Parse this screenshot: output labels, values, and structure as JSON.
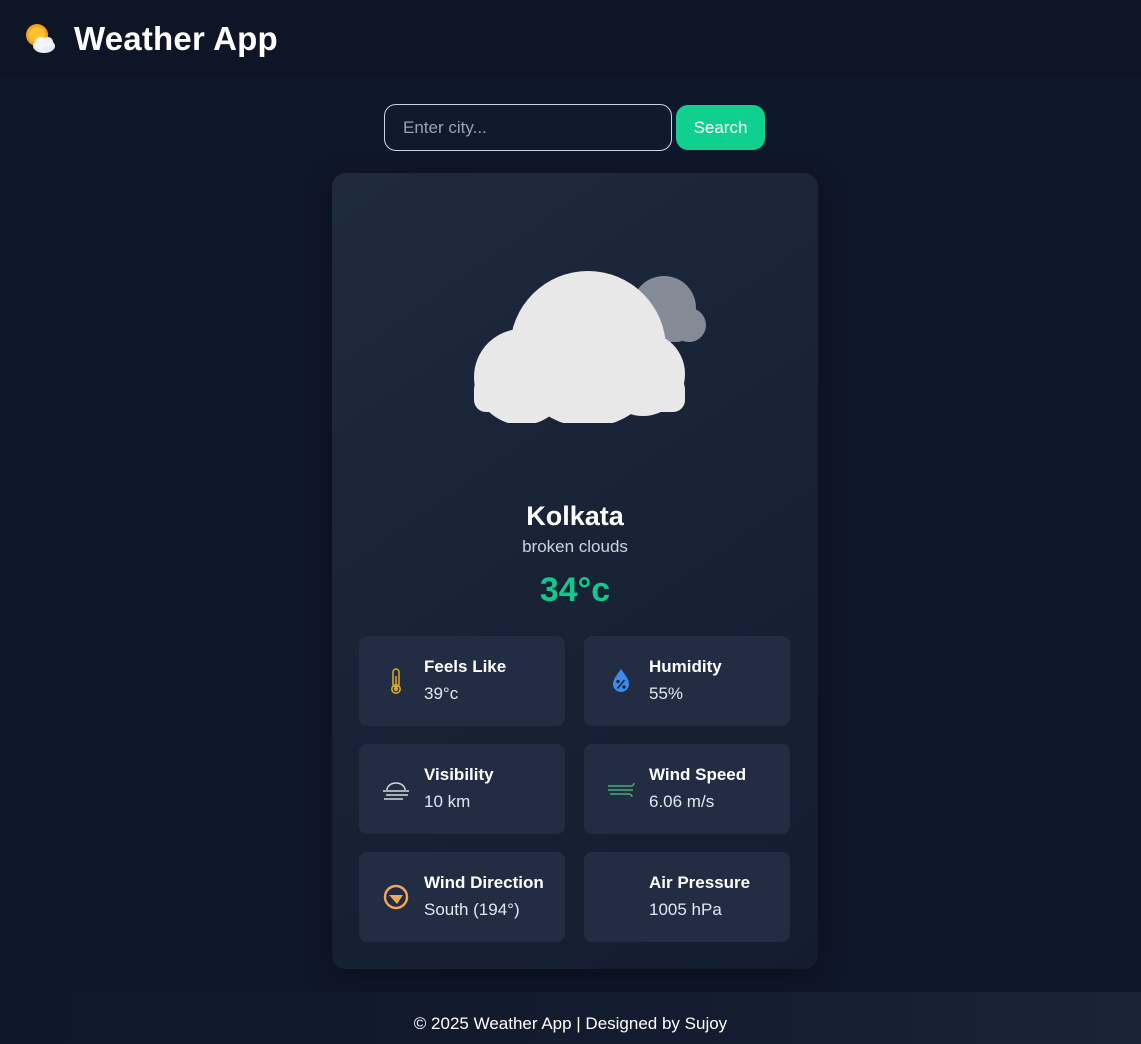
{
  "header": {
    "title": "Weather App",
    "logo_icon": "sun-behind-cloud-icon"
  },
  "search": {
    "placeholder": "Enter city...",
    "value": "",
    "button_label": "Search"
  },
  "weather": {
    "icon": "broken-clouds-icon",
    "city": "Kolkata",
    "description": "broken clouds",
    "temperature": "34°c"
  },
  "details": [
    {
      "label": "Feels Like",
      "value": "39°c",
      "icon": "thermometer-icon"
    },
    {
      "label": "Humidity",
      "value": "55%",
      "icon": "humidity-drop-icon"
    },
    {
      "label": "Visibility",
      "value": "10 km",
      "icon": "fog-icon"
    },
    {
      "label": "Wind Speed",
      "value": "6.06 m/s",
      "icon": "wind-icon"
    },
    {
      "label": "Wind Direction",
      "value": "South (194°)",
      "icon": "compass-icon"
    },
    {
      "label": "Air Pressure",
      "value": "1005 hPa",
      "icon": ""
    }
  ],
  "footer": {
    "text": "© 2025 Weather App | Designed by Sujoy"
  },
  "colors": {
    "accent": "#10d090",
    "background": "#0f172a",
    "card": "#1c263a",
    "temperature": "#10c98a"
  }
}
